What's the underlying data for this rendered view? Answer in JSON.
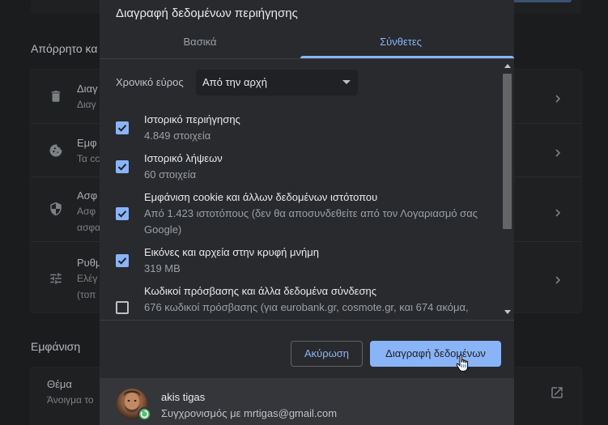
{
  "background": {
    "sections": [
      {
        "title": "Απόρρητο κα",
        "rows": [
          {
            "icon": "trash-icon",
            "title": "Διαγ",
            "subtitle": "Διαγ"
          },
          {
            "icon": "cookie-icon",
            "title": "Εμφ",
            "subtitle": "Τα cc"
          },
          {
            "icon": "shield-icon",
            "title": "Ασφ",
            "subtitle": "Ασφ",
            "subtitle2": "ασφα"
          },
          {
            "icon": "tune-icon",
            "title": "Ρυθμ",
            "subtitle": "Ελέγ",
            "subtitle2": "(τοπ"
          }
        ]
      },
      {
        "title": "Εμφάνιση",
        "rows": [
          {
            "icon": "external-link-icon",
            "title": "Θέμα",
            "subtitle": "Άνοιγμα το"
          }
        ]
      }
    ]
  },
  "dialog": {
    "title": "Διαγραφή δεδομένων περιήγησης",
    "tabs": [
      {
        "label": "Βασικά",
        "selected": false
      },
      {
        "label": "Σύνθετες",
        "selected": true
      }
    ],
    "time_range": {
      "label": "Χρονικό εύρος",
      "selected": "Από την αρχή"
    },
    "items": [
      {
        "title": "Ιστορικό περιήγησης",
        "subtitle": "4.849 στοιχεία",
        "checked": true
      },
      {
        "title": "Ιστορικό λήψεων",
        "subtitle": "60 στοιχεία",
        "checked": true
      },
      {
        "title": "Εμφάνιση cookie και άλλων δεδομένων ιστότοπου",
        "subtitle": "Από 1.423 ιστοτόπους (δεν θα αποσυνδεθείτε από τον Λογαριασμό σας Google)",
        "checked": true
      },
      {
        "title": "Εικόνες και αρχεία στην κρυφή μνήμη",
        "subtitle": "319 MB",
        "checked": true
      },
      {
        "title": "Κωδικοί πρόσβασης και άλλα δεδομένα σύνδεσης",
        "subtitle": "676 κωδικοί πρόσβασης (για eurobank.gr, cosmote.gr, και 674 ακόμα,",
        "checked": false
      }
    ],
    "buttons": {
      "cancel": "Ακύρωση",
      "delete": "Διαγραφή δεδομένων"
    },
    "account": {
      "name": "akis tigas",
      "sync_text": "Συγχρονισμός με mrtigas@gmail.com"
    }
  },
  "colors": {
    "accent": "#8ab4f8",
    "dialog_bg": "#292a2d",
    "footer_bg": "#35363a"
  }
}
